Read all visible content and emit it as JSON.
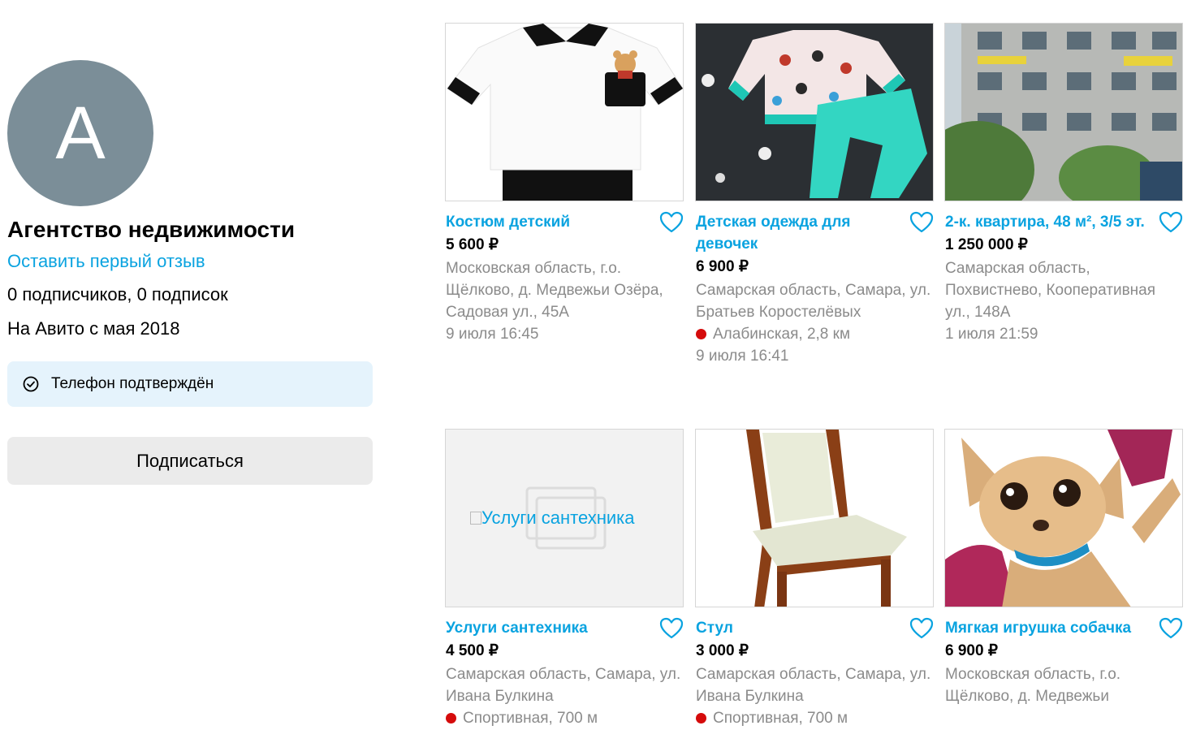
{
  "seller": {
    "avatar_letter": "A",
    "name": "Агентство недвижимости",
    "review_link": "Оставить первый отзыв",
    "subscriptions": "0 подписчиков, 0 подписок",
    "since": "На Авито с мая 2018",
    "verified": "Телефон подтверждён",
    "subscribe_button": "Подписаться"
  },
  "listings": [
    {
      "title": "Костюм детский",
      "price": "5 600 ₽",
      "address": "Московская область, г.о. Щёлково, д. Медвежьи Озёра, Садовая ул., 45А",
      "metro": "",
      "date": "9 июля 16:45",
      "image": "white-shirt-photo"
    },
    {
      "title": "Детская одежда для девочек",
      "price": "6 900 ₽",
      "address": "Самарская область, Самара, ул. Братьев Коростелёвых",
      "metro": "Алабинская, 2,8 км",
      "date": "9 июля 16:41",
      "image": "kids-clothes-photo"
    },
    {
      "title": "2-к. квартира, 48 м², 3/5 эт.",
      "price": "1 250 000 ₽",
      "address": "Самарская область, Похвистнево, Кооперативная ул., 148А",
      "metro": "",
      "date": "1 июля 21:59",
      "image": "apartment-building-photo"
    },
    {
      "title": "Услуги сантехника",
      "price": "4 500 ₽",
      "address": "Самарская область, Самара, ул. Ивана Булкина",
      "metro": "Спортивная, 700 м",
      "date": "",
      "image": "broken-image",
      "image_alt": "Услуги сантехника"
    },
    {
      "title": "Стул",
      "price": "3 000 ₽",
      "address": "Самарская область, Самара, ул. Ивана Булкина",
      "metro": "Спортивная, 700 м",
      "date": "",
      "image": "chair-photo"
    },
    {
      "title": "Мягкая игрушка собачка",
      "price": "6 900 ₽",
      "address": "Московская область, г.о. Щёлково, д. Медвежьи",
      "metro": "",
      "date": "",
      "image": "plush-dog-photo"
    }
  ],
  "colors": {
    "link": "#0aa3e0",
    "metro_dot": "#d50b0b",
    "avatar_bg": "#7b8e98",
    "verified_bg": "#e5f3fc",
    "button_bg": "#ebebeb"
  }
}
